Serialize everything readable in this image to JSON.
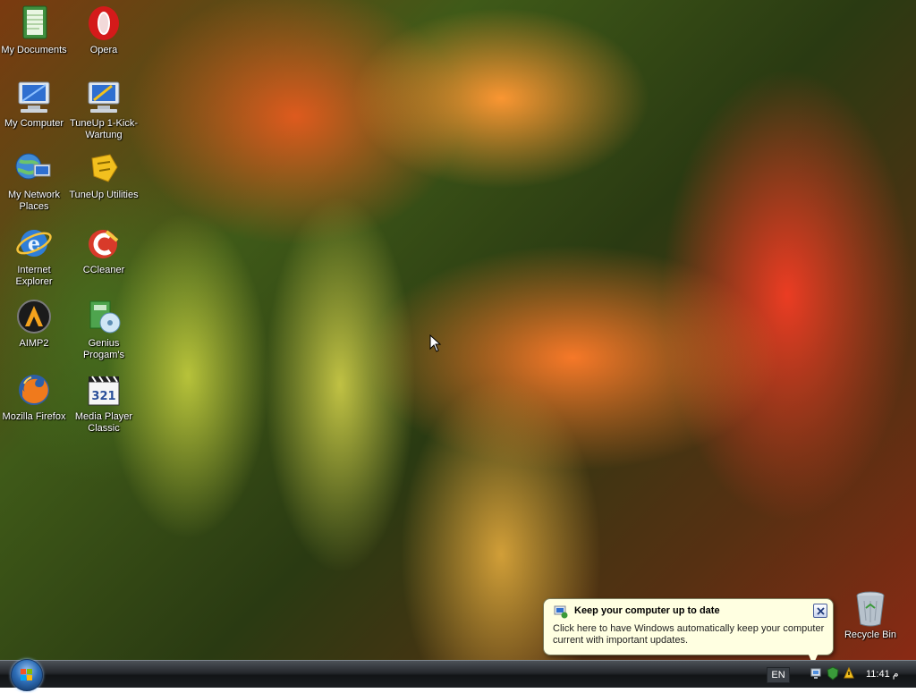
{
  "desktop": {
    "icons_left": [
      {
        "label": "My Documents",
        "icon": "my-documents-icon"
      },
      {
        "label": "My Computer",
        "icon": "my-computer-icon"
      },
      {
        "label": "My Network Places",
        "icon": "network-places-icon"
      },
      {
        "label": "Internet Explorer",
        "icon": "internet-explorer-icon"
      },
      {
        "label": "AIMP2",
        "icon": "aimp2-icon"
      },
      {
        "label": "Mozilla Firefox",
        "icon": "firefox-icon"
      }
    ],
    "icons_right": [
      {
        "label": "Opera",
        "icon": "opera-icon"
      },
      {
        "label": "TuneUp 1-Kick-Wartung",
        "icon": "tuneup-kick-icon"
      },
      {
        "label": "TuneUp Utilities",
        "icon": "tuneup-utilities-icon"
      },
      {
        "label": "CCleaner",
        "icon": "ccleaner-icon"
      },
      {
        "label": "Genius Progam's",
        "icon": "genius-programs-icon"
      },
      {
        "label": "Media Player Classic",
        "icon": "media-player-classic-icon"
      }
    ],
    "recycle_bin": {
      "label": "Recycle Bin",
      "icon": "recycle-bin-icon"
    }
  },
  "balloon": {
    "title": "Keep your computer up to date",
    "text": "Click here to have Windows automatically keep your computer current with important updates.",
    "icon": "windows-update-icon"
  },
  "taskbar": {
    "language": "EN",
    "clock": "11:41 م",
    "tray_icons": [
      "network-icon",
      "security-icon",
      "update-icon"
    ]
  },
  "colors": {
    "balloon_bg": "#ffffe1",
    "taskbar": "#1c1f22"
  }
}
